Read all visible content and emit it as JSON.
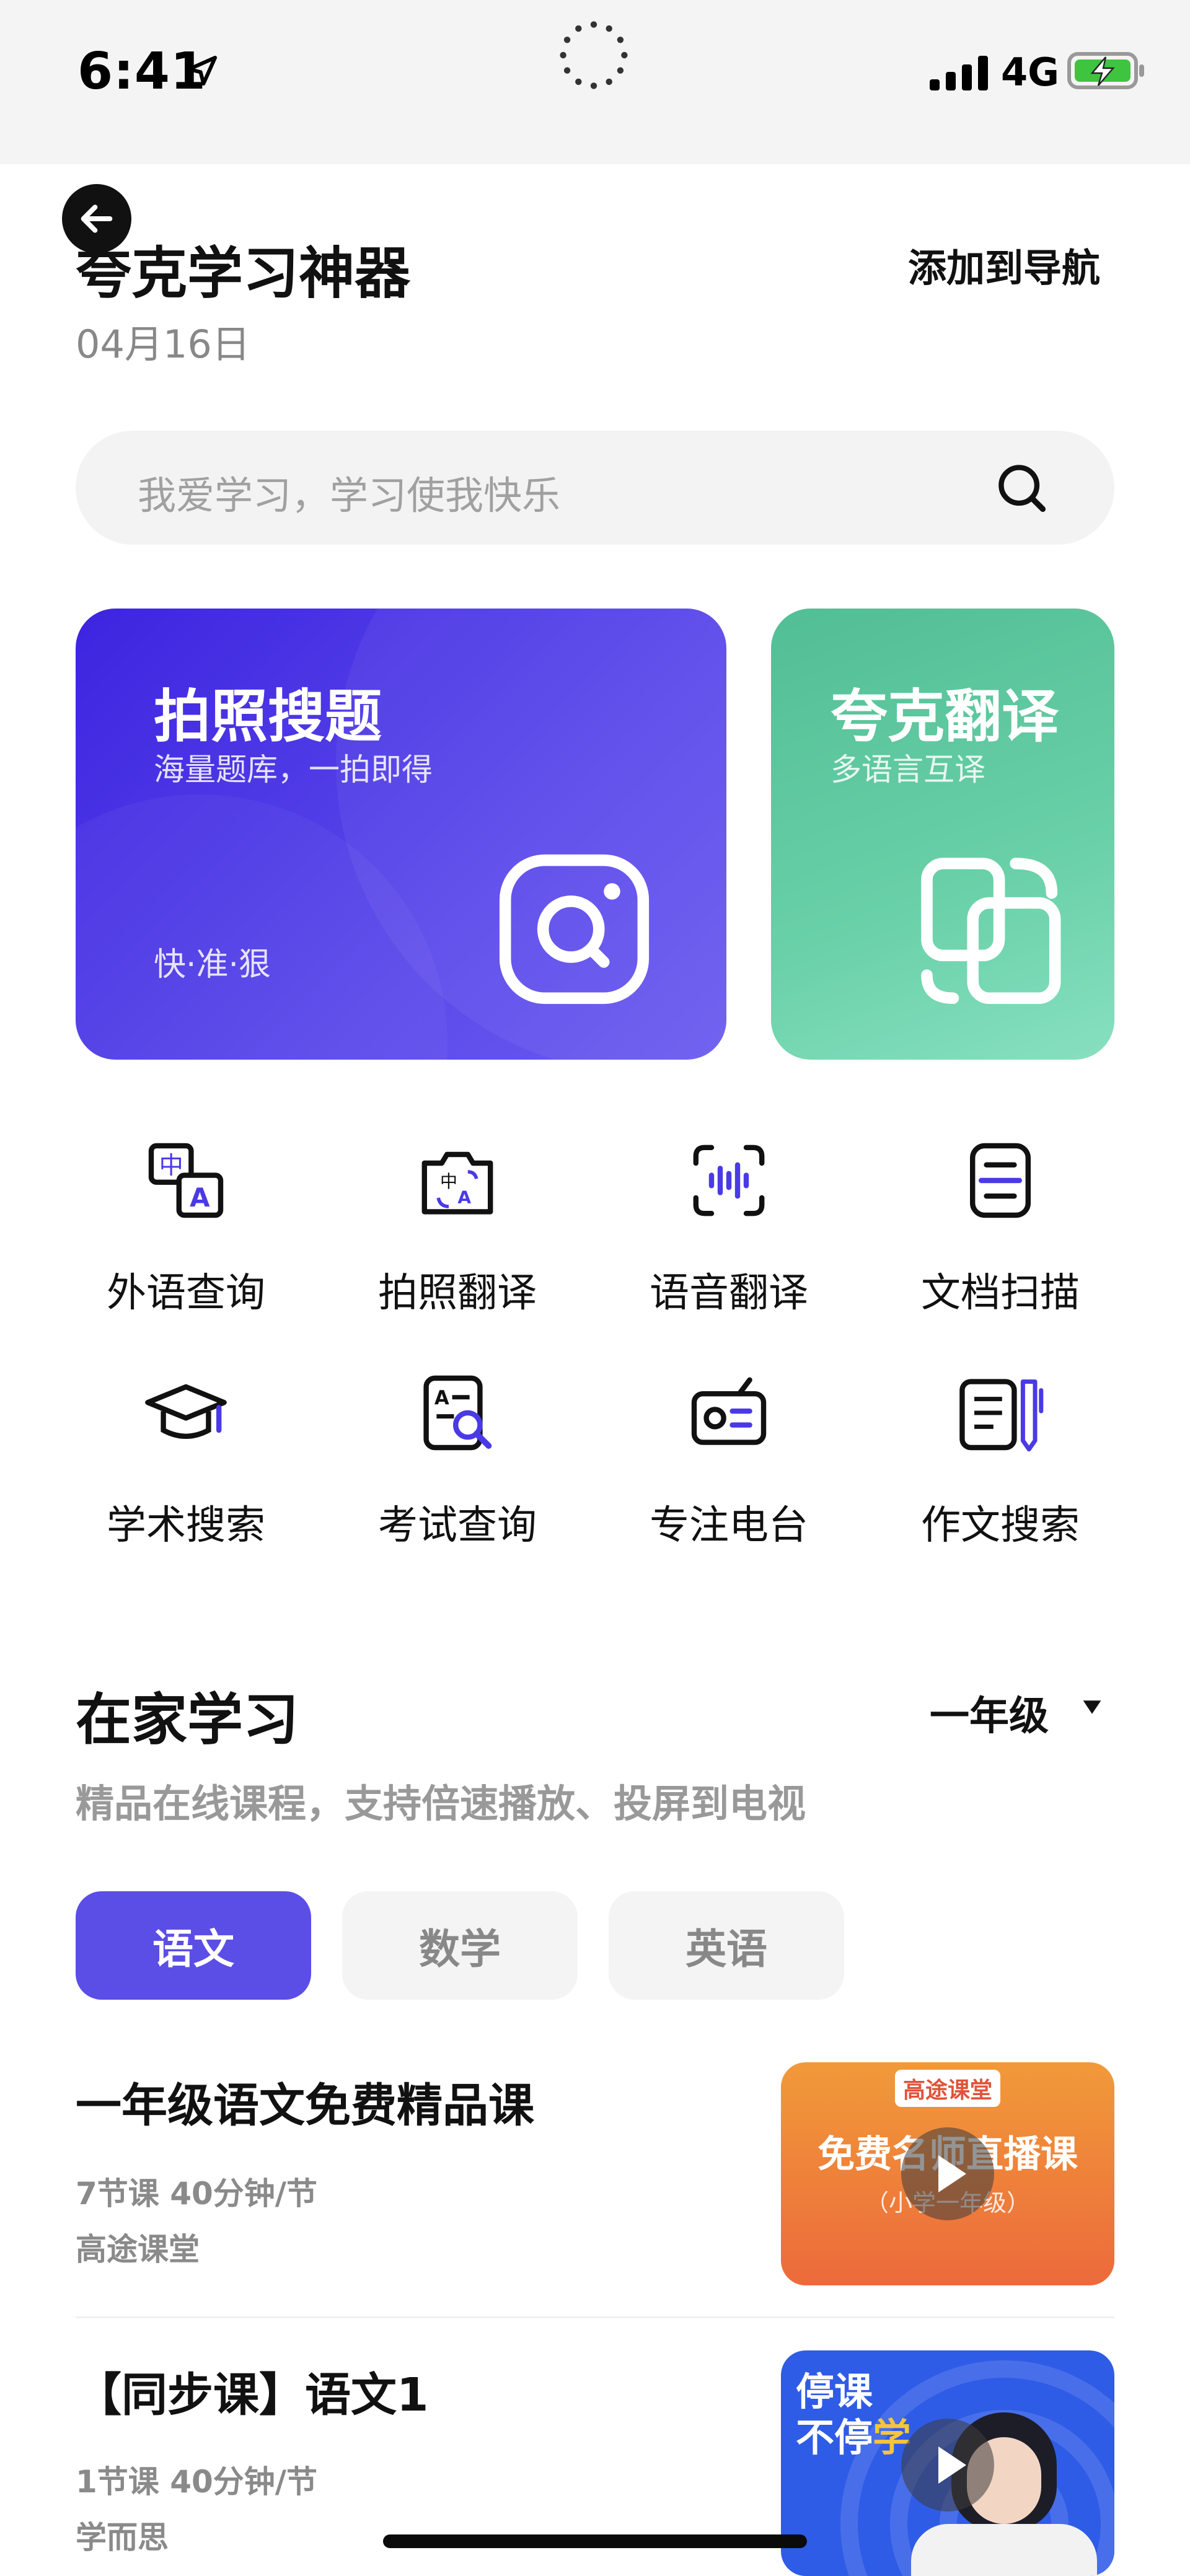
{
  "status_bar": {
    "time": "6:41",
    "network": "4G"
  },
  "header": {
    "title": "夸克学习神器",
    "add_to_nav": "添加到导航",
    "date": "04月16日"
  },
  "search": {
    "placeholder": "我爱学习，学习使我快乐"
  },
  "cards": {
    "photo_search": {
      "title": "拍照搜题",
      "subtitle": "海量题库，一拍即得",
      "tagline": "快·准·狠"
    },
    "translate": {
      "title": "夸克翻译",
      "subtitle": "多语言互译"
    }
  },
  "tools": [
    {
      "label": "外语查询",
      "icon": "foreign-language-icon"
    },
    {
      "label": "拍照翻译",
      "icon": "camera-translate-icon"
    },
    {
      "label": "语音翻译",
      "icon": "voice-translate-icon"
    },
    {
      "label": "文档扫描",
      "icon": "document-scan-icon"
    },
    {
      "label": "学术搜索",
      "icon": "academic-cap-icon"
    },
    {
      "label": "考试查询",
      "icon": "exam-search-icon"
    },
    {
      "label": "专注电台",
      "icon": "radio-icon"
    },
    {
      "label": "作文搜索",
      "icon": "essay-search-icon"
    }
  ],
  "study": {
    "title": "在家学习",
    "grade": "一年级",
    "subtitle": "精品在线课程，支持倍速播放、投屏到电视",
    "subjects": [
      "语文",
      "数学",
      "英语"
    ],
    "active_subject": "语文",
    "courses": [
      {
        "title": "一年级语文免费精品课",
        "meta": "7节课 40分钟/节",
        "provider": "高途课堂",
        "thumb_badge": "高途课堂",
        "thumb_title": "免费名师直播课",
        "thumb_sub": "（小学一年级）"
      },
      {
        "title": "【同步课】语文1",
        "meta": "1节课 40分钟/节",
        "provider": "学而思",
        "thumb_line1": "停课",
        "thumb_line2a": "不停",
        "thumb_line2b": "学"
      }
    ]
  },
  "colors": {
    "accent": "#5b4ee6",
    "photo_card": "#4630e3",
    "translate_card": "#5cc49c",
    "icon_accent": "#4a3ae6"
  }
}
